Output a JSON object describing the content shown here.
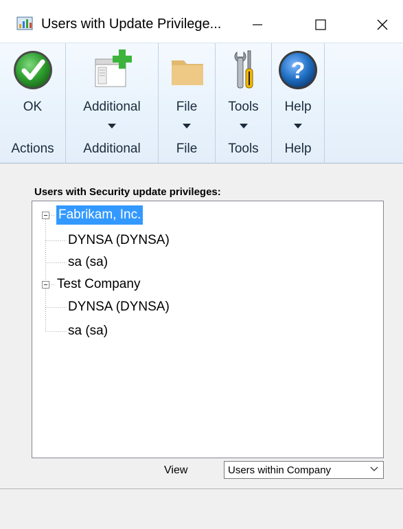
{
  "window": {
    "title": "Users with Update Privilege..."
  },
  "ribbon": {
    "groups": [
      {
        "label": "OK",
        "caption": "Actions",
        "icon": "checkmark-icon",
        "has_dropdown": false
      },
      {
        "label": "Additional",
        "caption": "Additional",
        "icon": "add-window-icon",
        "has_dropdown": true
      },
      {
        "label": "File",
        "caption": "File",
        "icon": "folder-icon",
        "has_dropdown": true
      },
      {
        "label": "Tools",
        "caption": "Tools",
        "icon": "tools-icon",
        "has_dropdown": true
      },
      {
        "label": "Help",
        "caption": "Help",
        "icon": "help-icon",
        "has_dropdown": true
      }
    ]
  },
  "tree": {
    "heading": "Users with Security update privileges:",
    "companies": [
      {
        "name": "Fabrikam, Inc.",
        "selected": true,
        "users": [
          "DYNSA (DYNSA)",
          "sa (sa)"
        ]
      },
      {
        "name": "Test Company",
        "selected": false,
        "users": [
          "DYNSA (DYNSA)",
          "sa (sa)"
        ]
      }
    ]
  },
  "view": {
    "label": "View",
    "selected": "Users within Company"
  },
  "colors": {
    "selection": "#3399ff",
    "ok_green": "#2e9e2e",
    "help_blue": "#1f6fc2"
  }
}
